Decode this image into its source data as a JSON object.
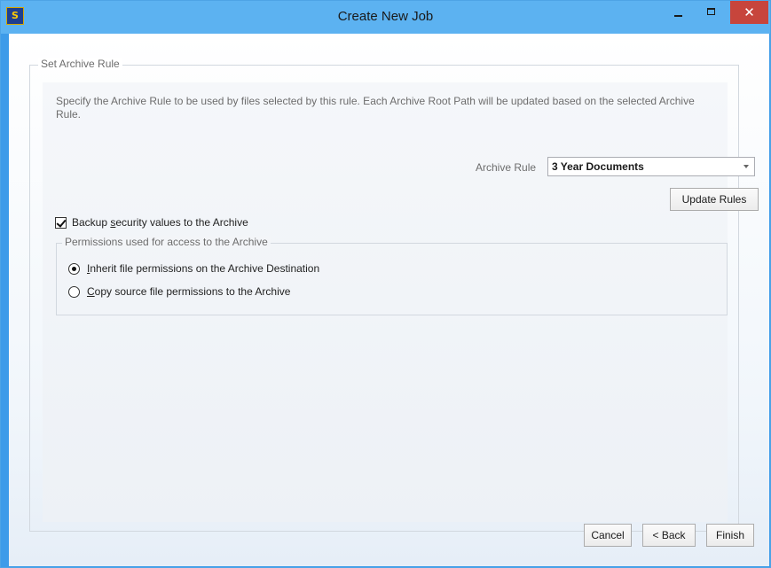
{
  "window": {
    "title": "Create New Job",
    "app_icon": "S",
    "close_glyph": "✕"
  },
  "archive_rule_group": {
    "label": "Set Archive Rule",
    "description": "Specify the Archive Rule to be used by files selected by this rule. Each Archive Root Path will be updated based on the selected Archive Rule.",
    "rule_label": "Archive Rule",
    "rule_value": "3 Year Documents",
    "update_button": "Update Rules"
  },
  "backup_security": {
    "checked": true,
    "label_before": "Backup ",
    "label_accel": "s",
    "label_after": "ecurity values to the Archive"
  },
  "permissions_group": {
    "label": "Permissions used for access to the Archive",
    "options": [
      {
        "selected": true,
        "accel": "I",
        "rest": "nherit file permissions on the Archive Destination"
      },
      {
        "selected": false,
        "accel": "C",
        "rest": "opy source file permissions to the Archive"
      }
    ]
  },
  "footer": {
    "cancel": "Cancel",
    "back": "< Back",
    "finish": "Finish"
  },
  "colors": {
    "titlebar": "#5cb2f1",
    "close_button": "#c7453c",
    "window_border": "#3d9be9"
  },
  "icons": [
    "app-logo-icon",
    "minimize-icon",
    "maximize-icon",
    "close-icon",
    "checkmark-icon",
    "dropdown-arrow-icon",
    "radio-dot-icon"
  ]
}
